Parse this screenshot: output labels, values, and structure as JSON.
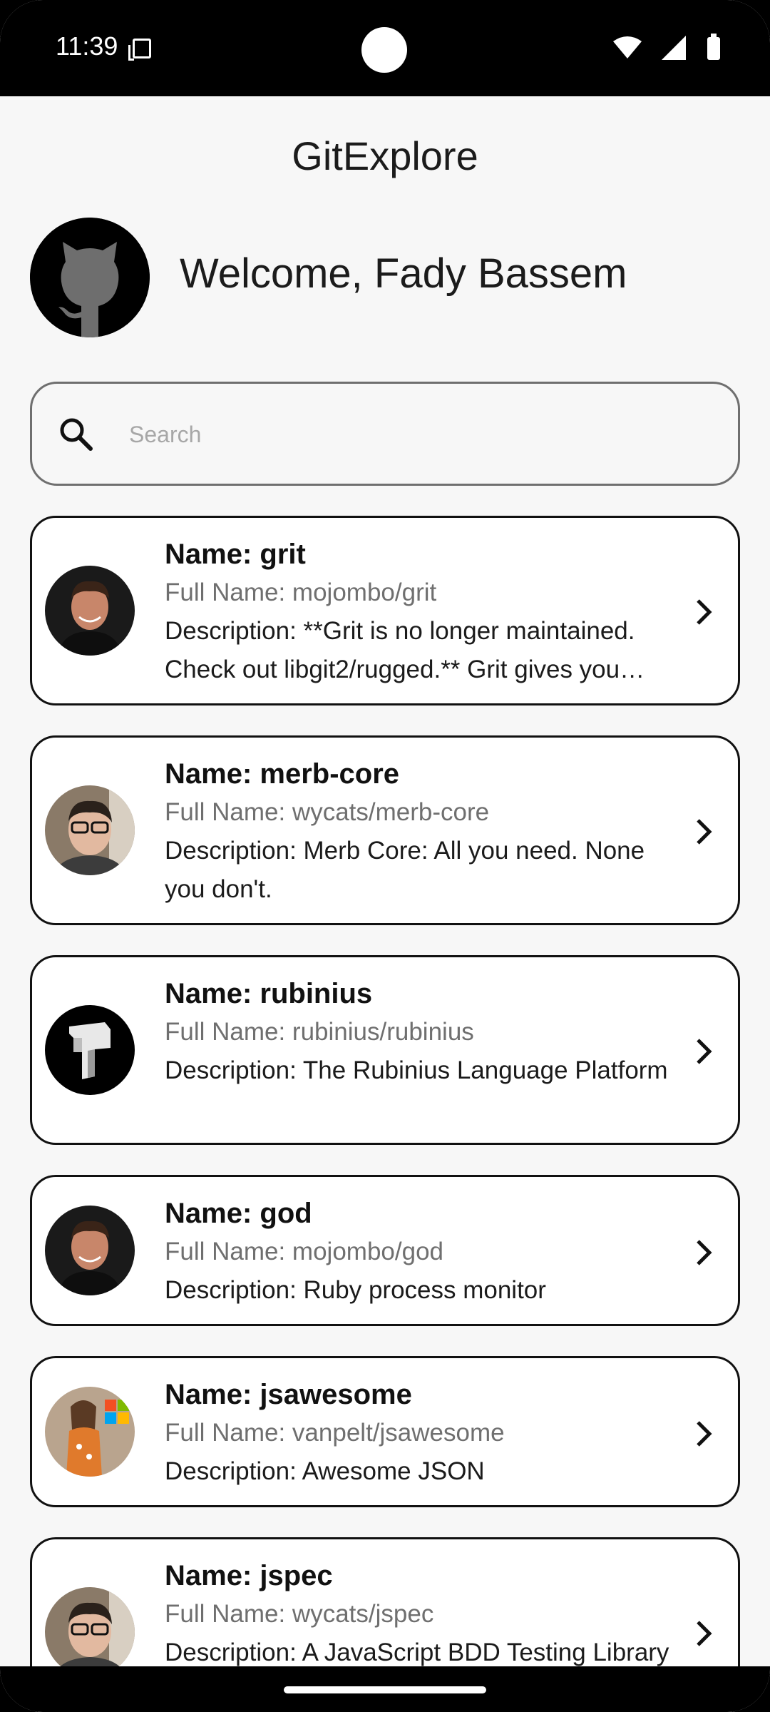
{
  "status_bar": {
    "time": "11:39"
  },
  "header": {
    "title": "GitExplore"
  },
  "profile": {
    "welcome": "Welcome, Fady Bassem",
    "avatar_icon": "github-octocat-icon"
  },
  "search": {
    "placeholder": "Search",
    "value": ""
  },
  "repos": [
    {
      "name": "Name: grit",
      "full_name": "Full Name: mojombo/grit",
      "description": "Description: **Grit is no longer maintained. Check out libgit2/rugged.** Grit gives you object oriented read/write access to Git repositories via Ruby."
    },
    {
      "name": "Name: merb-core",
      "full_name": "Full Name: wycats/merb-core",
      "description": "Description: Merb Core: All you need. None you don't."
    },
    {
      "name": "Name: rubinius",
      "full_name": "Full Name: rubinius/rubinius",
      "description": "Description: The Rubinius Language Platform"
    },
    {
      "name": "Name: god",
      "full_name": "Full Name: mojombo/god",
      "description": "Description: Ruby process monitor"
    },
    {
      "name": "Name: jsawesome",
      "full_name": "Full Name: vanpelt/jsawesome",
      "description": "Description: Awesome JSON"
    },
    {
      "name": "Name: jspec",
      "full_name": "Full Name: wycats/jspec",
      "description": "Description: A JavaScript BDD Testing Library"
    }
  ]
}
